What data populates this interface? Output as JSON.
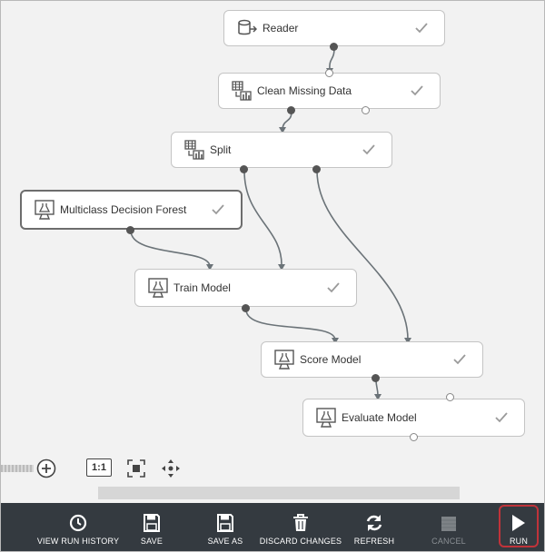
{
  "canvas": {
    "modules": [
      {
        "id": "reader",
        "label": "Reader",
        "icon": "database-icon",
        "status": "complete"
      },
      {
        "id": "clean-missing-data",
        "label": "Clean Missing Data",
        "icon": "table-transform-icon",
        "status": "complete"
      },
      {
        "id": "split",
        "label": "Split",
        "icon": "table-transform-icon",
        "status": "complete"
      },
      {
        "id": "multiclass-decision-forest",
        "label": "Multiclass Decision Forest",
        "icon": "flask-monitor-icon",
        "status": "complete",
        "selected": true
      },
      {
        "id": "train-model",
        "label": "Train Model",
        "icon": "flask-monitor-icon",
        "status": "complete"
      },
      {
        "id": "score-model",
        "label": "Score Model",
        "icon": "flask-monitor-icon",
        "status": "complete"
      },
      {
        "id": "evaluate-model",
        "label": "Evaluate Model",
        "icon": "flask-monitor-icon",
        "status": "complete"
      }
    ],
    "connections": [
      {
        "from": "reader",
        "to": "clean-missing-data"
      },
      {
        "from": "clean-missing-data",
        "to": "split"
      },
      {
        "from": "split",
        "to": "train-model"
      },
      {
        "from": "split",
        "to": "score-model"
      },
      {
        "from": "multiclass-decision-forest",
        "to": "train-model"
      },
      {
        "from": "train-model",
        "to": "score-model"
      },
      {
        "from": "score-model",
        "to": "evaluate-model"
      }
    ]
  },
  "zoom_controls": {
    "actual_size_label": "1:1",
    "zoom_in_icon": "zoom-in-icon",
    "fit_icon": "fit-to-screen-icon",
    "pan_icon": "pan-icon"
  },
  "toolbar": {
    "buttons": [
      {
        "id": "view-run-history",
        "label": "VIEW RUN HISTORY",
        "icon": "history-icon",
        "enabled": true
      },
      {
        "id": "save",
        "label": "SAVE",
        "icon": "save-icon",
        "enabled": true
      },
      {
        "id": "save-as",
        "label": "SAVE AS",
        "icon": "save-as-icon",
        "enabled": true
      },
      {
        "id": "discard-changes",
        "label": "DISCARD CHANGES",
        "icon": "trash-icon",
        "enabled": true
      },
      {
        "id": "refresh",
        "label": "REFRESH",
        "icon": "refresh-icon",
        "enabled": true
      },
      {
        "id": "cancel",
        "label": "CANCEL",
        "icon": "stop-icon",
        "enabled": false
      },
      {
        "id": "run",
        "label": "RUN",
        "icon": "play-icon",
        "enabled": true,
        "highlighted": true
      }
    ]
  },
  "colors": {
    "toolbar_bg": "#343a40",
    "canvas_bg": "#f2f2f2",
    "run_highlight": "#c0333a",
    "check": "#9a9a9a"
  }
}
